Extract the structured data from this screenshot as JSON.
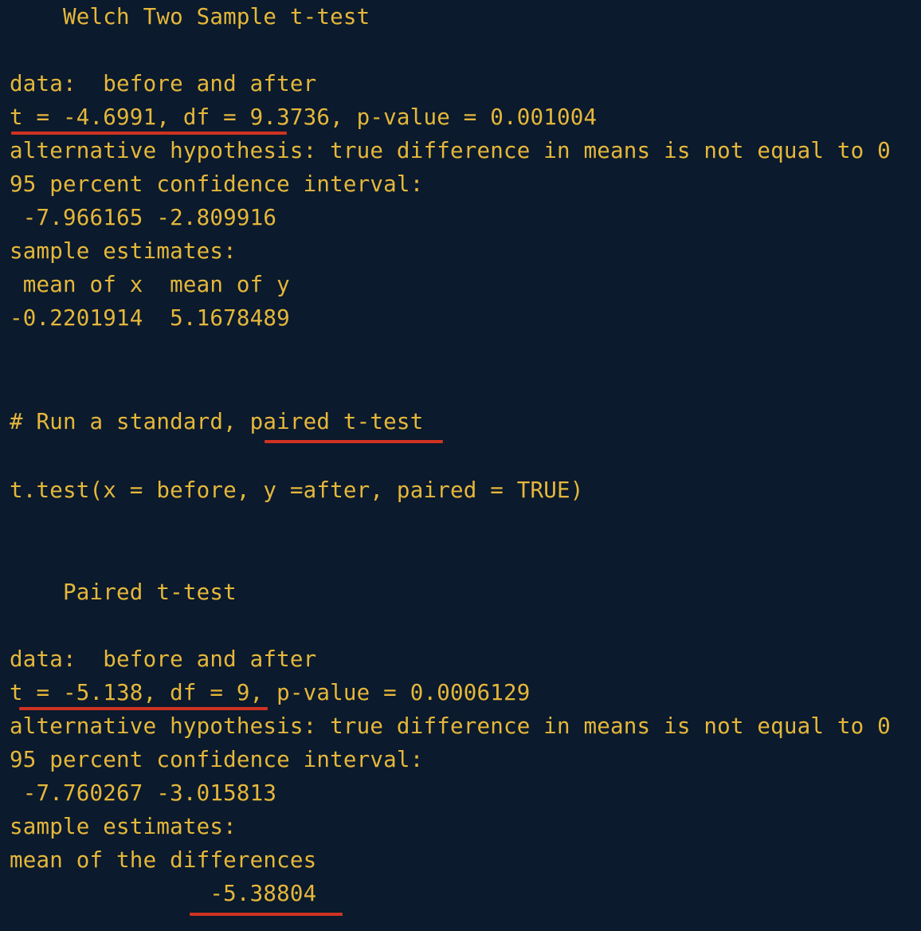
{
  "colors": {
    "background": "#0b1a2c",
    "text": "#e5b73b",
    "underline": "#cf3322"
  },
  "welch": {
    "title": "    Welch Two Sample t-test",
    "data_line": "data:  before and after",
    "stats_line": "t = -4.6991, df = 9.3736, p-value = 0.001004",
    "alternative_line": "alternative hypothesis: true difference in means is not equal to 0",
    "ci_label": "95 percent confidence interval:",
    "ci_values": " -7.966165 -2.809916",
    "estimates_label": "sample estimates:",
    "estimates_header": " mean of x  mean of y",
    "estimates_values": "-0.2201914  5.1678489"
  },
  "command": {
    "comment": "# Run a standard, paired t-test",
    "code": "t.test(x = before, y =after, paired = TRUE)"
  },
  "paired": {
    "title": "    Paired t-test",
    "data_line": "data:  before and after",
    "stats_line": "t = -5.138, df = 9, p-value = 0.0006129",
    "alternative_line": "alternative hypothesis: true difference in means is not equal to 0",
    "ci_label": "95 percent confidence interval:",
    "ci_values": " -7.760267 -3.015813",
    "estimates_label": "sample estimates:",
    "estimates_header": "mean of the differences",
    "estimates_values": "               -5.38804"
  }
}
